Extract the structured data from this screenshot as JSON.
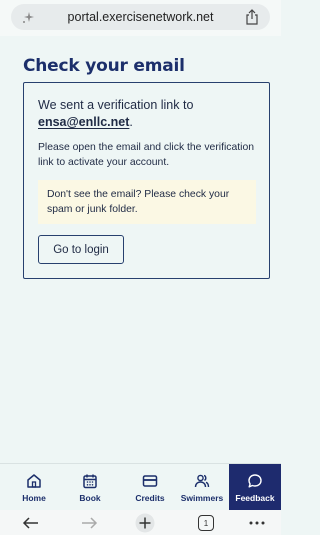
{
  "browser": {
    "url": "portal.exercisenetwork.net",
    "tab_count": "1"
  },
  "page": {
    "title": "Check your email",
    "lead_text": "We sent a verification link to",
    "email": "ensa@enllc.net",
    "email_suffix": ".",
    "instructions": "Please open the email and click the verification link to activate your account.",
    "notice": "Don't see the email? Please check your spam or junk folder.",
    "login_button": "Go to login"
  },
  "tabs": [
    {
      "label": "Home",
      "icon": "home-icon"
    },
    {
      "label": "Book",
      "icon": "calendar-icon"
    },
    {
      "label": "Credits",
      "icon": "card-icon"
    },
    {
      "label": "Swimmers",
      "icon": "people-icon"
    },
    {
      "label": "Feedback",
      "icon": "chat-bubble-icon",
      "active": true
    }
  ],
  "colors": {
    "brand": "#1c2f6b",
    "feedback_bg": "#1e2b6e",
    "notice_bg": "#fbf8e4",
    "background": "#eef6f5"
  }
}
